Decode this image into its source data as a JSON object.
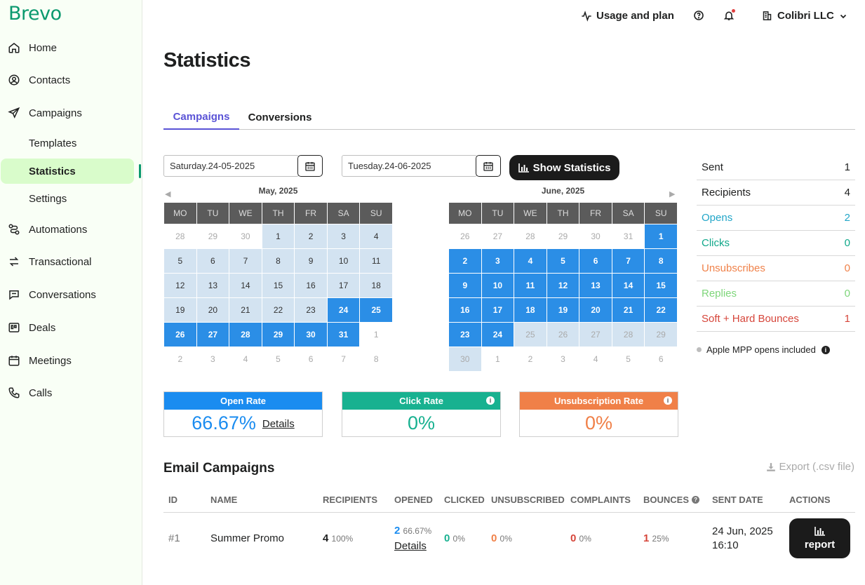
{
  "brand": {
    "logo": "Brevo",
    "accent": "#0b996e"
  },
  "sidebar": {
    "items": [
      {
        "label": "Home",
        "icon": "home-icon"
      },
      {
        "label": "Contacts",
        "icon": "contacts-icon"
      },
      {
        "label": "Campaigns",
        "icon": "send-icon"
      },
      {
        "label": "Templates"
      },
      {
        "label": "Statistics"
      },
      {
        "label": "Settings"
      },
      {
        "label": "Automations",
        "icon": "automation-icon"
      },
      {
        "label": "Transactional",
        "icon": "transactional-icon"
      },
      {
        "label": "Conversations",
        "icon": "chat-icon"
      },
      {
        "label": "Deals",
        "icon": "deals-icon"
      },
      {
        "label": "Meetings",
        "icon": "calendar-icon"
      },
      {
        "label": "Calls",
        "icon": "phone-icon"
      }
    ]
  },
  "header": {
    "usage": "Usage and plan",
    "account": "Colibri LLC"
  },
  "page": {
    "title": "Statistics"
  },
  "tabs": [
    {
      "label": "Campaigns"
    },
    {
      "label": "Conversions"
    }
  ],
  "filters": {
    "start_date": "Saturday.24-05-2025",
    "end_date": "Tuesday.24-06-2025",
    "show_button": "Show Statistics"
  },
  "calendars": {
    "weekdays": [
      "MO",
      "TU",
      "WE",
      "TH",
      "FR",
      "SA",
      "SU"
    ],
    "left": {
      "title": "May, 2025",
      "weeks": [
        [
          "28",
          "29",
          "30",
          "1",
          "2",
          "3",
          "4"
        ],
        [
          "5",
          "6",
          "7",
          "8",
          "9",
          "10",
          "11"
        ],
        [
          "12",
          "13",
          "14",
          "15",
          "16",
          "17",
          "18"
        ],
        [
          "19",
          "20",
          "21",
          "22",
          "23",
          "24",
          "25"
        ],
        [
          "26",
          "27",
          "28",
          "29",
          "30",
          "31",
          "1"
        ],
        [
          "2",
          "3",
          "4",
          "5",
          "6",
          "7",
          "8"
        ]
      ]
    },
    "right": {
      "title": "June, 2025",
      "weeks": [
        [
          "26",
          "27",
          "28",
          "29",
          "30",
          "31",
          "1"
        ],
        [
          "2",
          "3",
          "4",
          "5",
          "6",
          "7",
          "8"
        ],
        [
          "9",
          "10",
          "11",
          "12",
          "13",
          "14",
          "15"
        ],
        [
          "16",
          "17",
          "18",
          "19",
          "20",
          "21",
          "22"
        ],
        [
          "23",
          "24",
          "25",
          "26",
          "27",
          "28",
          "29"
        ],
        [
          "30",
          "1",
          "2",
          "3",
          "4",
          "5",
          "6"
        ]
      ]
    }
  },
  "summary": [
    {
      "label": "Sent",
      "value": "1",
      "color": "#1f2020"
    },
    {
      "label": "Recipients",
      "value": "4",
      "color": "#1f2020"
    },
    {
      "label": "Opens",
      "value": "2",
      "color": "#22a6c8"
    },
    {
      "label": "Clicks",
      "value": "0",
      "color": "#10a88a"
    },
    {
      "label": "Unsubscribes",
      "value": "0",
      "color": "#f0824a"
    },
    {
      "label": "Replies",
      "value": "0",
      "color": "#7ed67a"
    },
    {
      "label": "Soft + Hard Bounces",
      "value": "1",
      "color": "#d6453a"
    }
  ],
  "mpp_note": "Apple MPP opens included",
  "rates": [
    {
      "title": "Open Rate",
      "value": "66.67%",
      "link": "Details",
      "color": "#1a8cf0"
    },
    {
      "title": "Click Rate",
      "value": "0%",
      "color": "#18b190"
    },
    {
      "title": "Unsubscription Rate",
      "value": "0%",
      "color": "#f08048"
    }
  ],
  "campaigns": {
    "title": "Email Campaigns",
    "export": "Export (.csv file)",
    "columns": [
      "ID",
      "NAME",
      "RECIPIENTS",
      "OPENED",
      "CLICKED",
      "UNSUBSCRIBED",
      "COMPLAINTS",
      "BOUNCES",
      "SENT DATE",
      "ACTIONS"
    ],
    "rows": [
      {
        "id": "#1",
        "name": "Summer Promo",
        "recipients": "4",
        "recipients_pct": "100%",
        "opened": "2",
        "opened_pct": "66.67%",
        "opened_link": "Details",
        "clicked": "0",
        "clicked_pct": "0%",
        "unsubscribed": "0",
        "unsubscribed_pct": "0%",
        "bounces": "1",
        "bounces_pct": "25%",
        "sent_date": "24 Jun, 2025",
        "sent_time": "16:10",
        "action": "report"
      }
    ]
  }
}
